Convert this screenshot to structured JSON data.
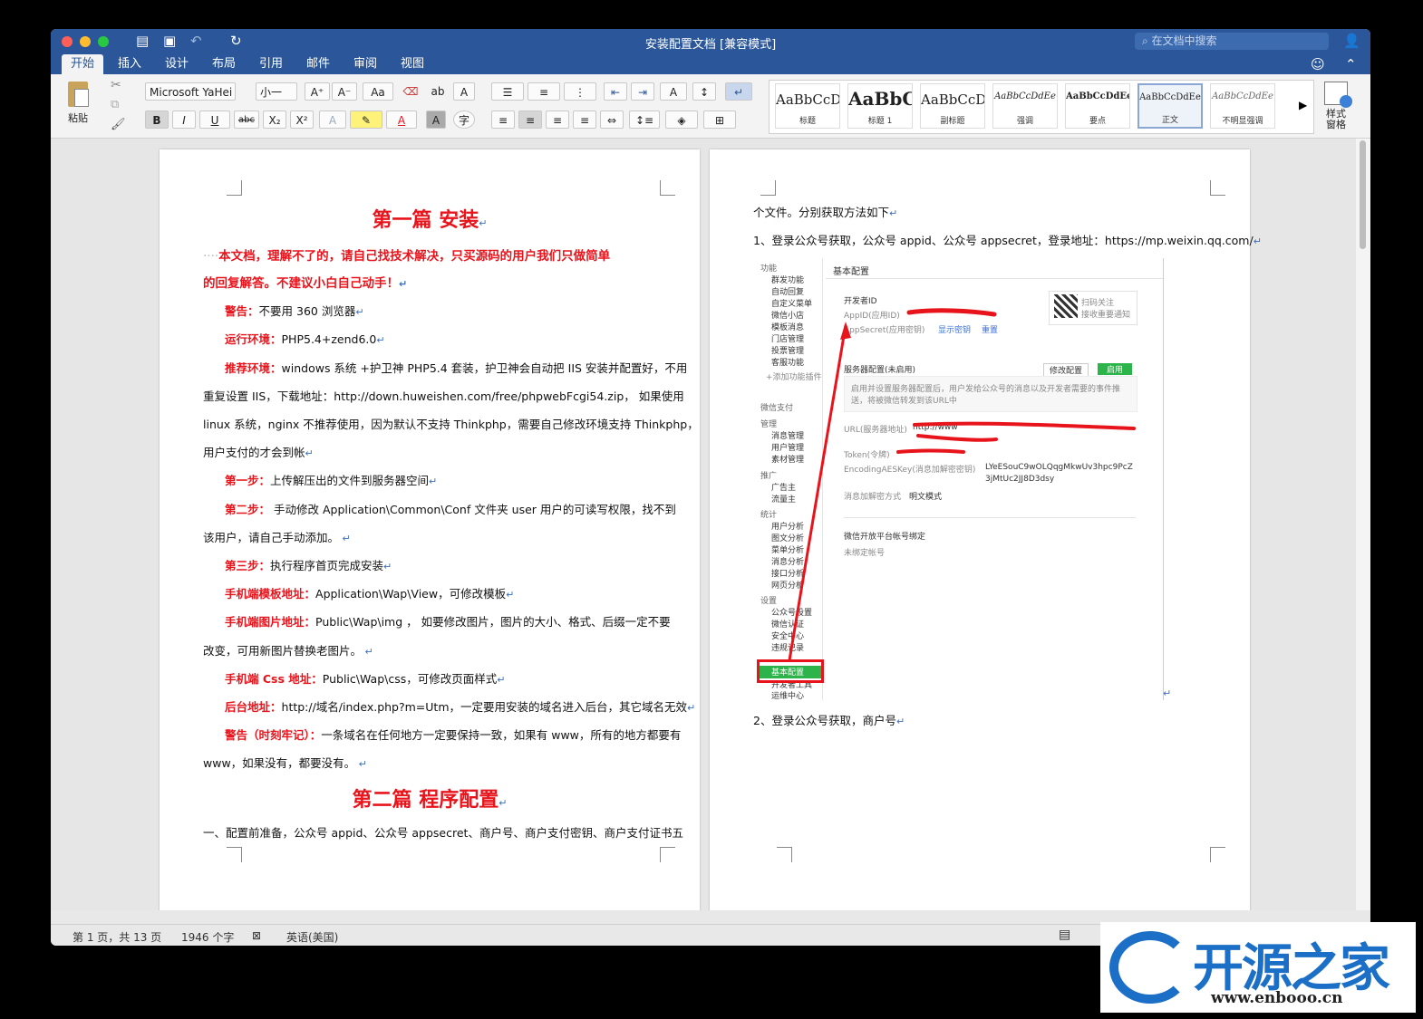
{
  "window": {
    "title": "安装配置文档 [兼容模式]",
    "search_placeholder": "在文档中搜索",
    "tabs": [
      "开始",
      "插入",
      "设计",
      "布局",
      "引用",
      "邮件",
      "审阅",
      "视图"
    ]
  },
  "ribbon": {
    "paste_label": "粘贴",
    "font_name": "Microsoft YaHei",
    "font_size": "小一",
    "styles": [
      {
        "sample": "AaBbCcDc",
        "name": "标题"
      },
      {
        "sample": "AaBbC",
        "name": "标题 1"
      },
      {
        "sample": "AaBbCcDc",
        "name": "副标题"
      },
      {
        "sample": "AaBbCcDdEe",
        "name": "强调"
      },
      {
        "sample": "AaBbCcDdEe",
        "name": "要点"
      },
      {
        "sample": "AaBbCcDdEe",
        "name": "正文"
      },
      {
        "sample": "AaBbCcDdEe",
        "name": "不明显强调"
      }
    ],
    "styles_pane_label": "样式窗格"
  },
  "page1": {
    "title": "第一篇 安装",
    "intro_1": "本文档，理解不了的，请自己找技术解决，只买源码的用户我们只做简单",
    "intro_2": "的回复解答。不建议小白自己动手！",
    "warn_label": "警告：",
    "warn_text": "不要用 360 浏览器",
    "env_label": "运行环境：",
    "env_text": "PHP5.4+zend6.0",
    "rec_label": "推荐环境：",
    "rec_text_1": "windows 系统 +护卫神 PHP5.4 套装，护卫神会自动把 IIS 安装并配置好，不用",
    "rec_text_2": "重复设置 IIS，下载地址：http://down.huweishen.com/free/phpwebFcgi54.zip， 如果使用",
    "rec_text_3": "linux 系统，nginx 不推荐使用，因为默认不支持 Thinkphp，需要自己修改环境支持 Thinkphp，",
    "rec_text_4": "用户支付的才会到帐",
    "step1_label": "第一步：",
    "step1_text": "上传解压出的文件到服务器空间",
    "step2_label": "第二步：",
    "step2_text_1": " 手动修改 Application\\Common\\Conf 文件夹 user 用户的可读写权限，找不到",
    "step2_text_2": "该用户，请自己手动添加。",
    "step3_label": "第三步：",
    "step3_text": "执行程序首页完成安装",
    "tpl_label": "手机端模板地址：",
    "tpl_text": "Application\\Wap\\View，可修改模板",
    "img_label": "手机端图片地址：",
    "img_text_1": "Public\\Wap\\img ， 如要修改图片，图片的大小、格式、后缀一定不要",
    "img_text_2": "改变，可用新图片替换老图片。",
    "css_label": "手机端 Css 地址：",
    "css_text": "Public\\Wap\\css，可修改页面样式",
    "admin_label": "后台地址：",
    "admin_text": "http://域名/index.php?m=Utm，一定要用安装的域名进入后台，其它域名无效",
    "remember_label": "警告（时刻牢记）：",
    "remember_text_1": "一条域名在任何地方一定要保持一致，如果有 www，所有的地方都要有",
    "remember_text_2": "www，如果没有，都要没有。",
    "title2": "第二篇 程序配置",
    "prep_text": "一、配置前准备，公众号 appid、公众号 appsecret、商户号、商户支付密钥、商户支付证书五"
  },
  "page2": {
    "line1": "个文件。分别获取方法如下",
    "line2": "1、登录公众号获取，公众号 appid、公众号 appsecret，登录地址：https://mp.weixin.qq.com/",
    "line3": "2、登录公众号获取，商户号",
    "screenshot": {
      "menu": [
        {
          "text": "功能",
          "head": true
        },
        {
          "text": "群发功能"
        },
        {
          "text": "自动回复"
        },
        {
          "text": "自定义菜单"
        },
        {
          "text": "微信小店"
        },
        {
          "text": "模板消息"
        },
        {
          "text": "门店管理"
        },
        {
          "text": "投票管理"
        },
        {
          "text": "客服功能"
        },
        {
          "text": "+添加功能插件"
        },
        {
          "text": "微信支付",
          "head": true
        },
        {
          "text": "管理",
          "head": true
        },
        {
          "text": "消息管理"
        },
        {
          "text": "用户管理"
        },
        {
          "text": "素材管理"
        },
        {
          "text": "推广",
          "head": true
        },
        {
          "text": "广告主"
        },
        {
          "text": "流量主"
        },
        {
          "text": "统计",
          "head": true
        },
        {
          "text": "用户分析"
        },
        {
          "text": "图文分析"
        },
        {
          "text": "菜单分析"
        },
        {
          "text": "消息分析"
        },
        {
          "text": "接口分析"
        },
        {
          "text": "网页分析"
        },
        {
          "text": "设置",
          "head": true
        },
        {
          "text": "公众号设置"
        },
        {
          "text": "微信认证"
        },
        {
          "text": "安全中心"
        },
        {
          "text": "违规记录"
        },
        {
          "text": "基本配置"
        },
        {
          "text": "开发者工具"
        },
        {
          "text": "运维中心"
        }
      ],
      "heading": "基本配置",
      "dev_id": "开发者ID",
      "appid_label": "AppID(应用ID)",
      "appsecret_label": "AppSecret(应用密钥)",
      "show_key": "显示密钥",
      "reset": "重置",
      "qr_1": "扫码关注",
      "qr_2": "接收重要通知",
      "server_cfg": "服务器配置(未启用)",
      "modify_cfg": "修改配置",
      "enable": "启用",
      "notice_1": "启用并设置服务器配置后，用户发给公众号的消息以及开发者需要的事件推",
      "notice_2": "送，将被微信转发到该URL中",
      "url_label": "URL(服务器地址)",
      "url_value": "http://www",
      "token_label": "Token(令牌)",
      "aes_label": "EncodingAESKey(消息加解密密钥)",
      "aes_value_1": "LYeESouC9wOLQqgMkwUv3hpc9PcZ",
      "aes_value_2": "3jMtUc2JJ8D3dsy",
      "encrypt_label": "消息加解密方式",
      "encrypt_value": "明文模式",
      "bind_title": "微信开放平台帐号绑定",
      "bind_status": "未绑定帐号"
    }
  },
  "status": {
    "page": "第 1 页，共 13 页",
    "words": "1946 个字",
    "lang": "英语(美国)"
  },
  "watermark": {
    "title": "开源之家",
    "url": "www.enbooo.cn"
  },
  "colors": {
    "accent": "#2b579a",
    "red": "#e8141c",
    "link": "#3c6fd6"
  }
}
